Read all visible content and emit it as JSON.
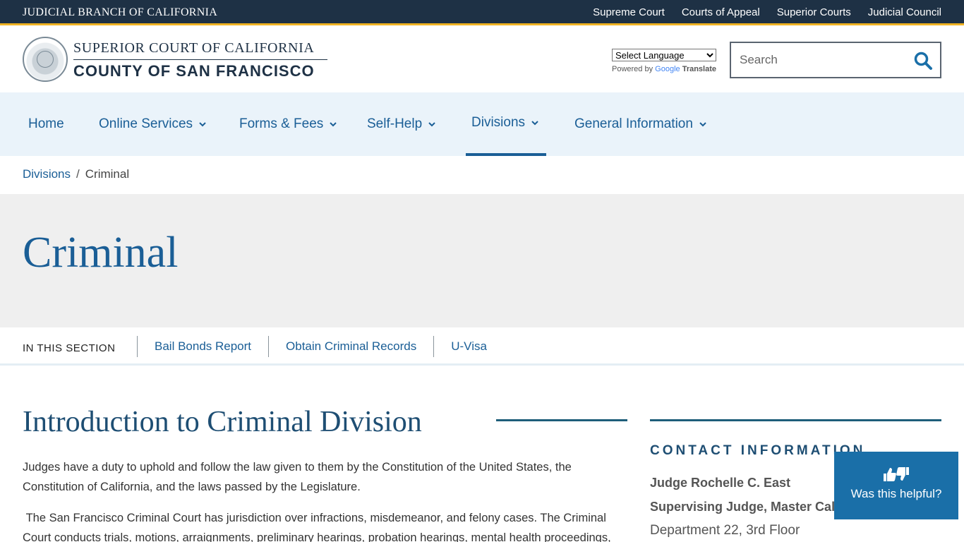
{
  "topbar": {
    "brand": "JUDICIAL BRANCH OF CALIFORNIA",
    "links": [
      "Supreme Court",
      "Courts of Appeal",
      "Superior Courts",
      "Judicial Council"
    ]
  },
  "header": {
    "seal_icon": "court-seal-icon",
    "court_line1": "SUPERIOR COURT OF CALIFORNIA",
    "court_line2": "COUNTY OF SAN FRANCISCO",
    "translate": {
      "select_value": "Select Language",
      "powered_by": "Powered by",
      "google": "Google",
      "translate_word": "Translate"
    },
    "search": {
      "placeholder": "Search",
      "icon": "search-icon"
    }
  },
  "nav": {
    "items": [
      {
        "label": "Home",
        "has_dropdown": false
      },
      {
        "label": "Online Services",
        "has_dropdown": true
      },
      {
        "label": "Forms & Fees",
        "has_dropdown": true
      },
      {
        "label": "Self-Help",
        "has_dropdown": true
      },
      {
        "label": "Divisions",
        "has_dropdown": true,
        "active": true
      },
      {
        "label": "General Information",
        "has_dropdown": true
      }
    ]
  },
  "breadcrumb": {
    "parent": "Divisions",
    "separator": "/",
    "current": "Criminal"
  },
  "hero": {
    "title": "Criminal"
  },
  "section_nav": {
    "label": "IN THIS SECTION",
    "links": [
      "Bail Bonds Report",
      "Obtain Criminal Records",
      "U-Visa"
    ]
  },
  "main": {
    "title": "Introduction to Criminal Division",
    "para1": "Judges have a duty to uphold and follow the law given to them by the Constitution of the United States, the Constitution of California, and the laws passed by the Legislature.",
    "para2": " The San Francisco Criminal Court has jurisdiction over infractions, misdemeanor, and felony cases. The Criminal Court conducts trials, motions, arraignments, preliminary hearings, probation hearings, mental health proceedings,"
  },
  "sidebar": {
    "contact_title": "CONTACT INFORMATION",
    "judge_name": "Judge Rochelle C. East",
    "judge_title": "Supervising Judge, Master Calendar",
    "department": "Department 22, 3rd Floor"
  },
  "helpful": {
    "label": "Was this helpful?",
    "icon": "thumbs-up-down-icon"
  },
  "colors": {
    "topbar_bg": "#1e3145",
    "topbar_accent": "#f0b323",
    "link_blue": "#1a5e96",
    "nav_bg": "#eaf3fa",
    "hero_bg": "#efefef",
    "helpful_bg": "#1a6fa8"
  }
}
